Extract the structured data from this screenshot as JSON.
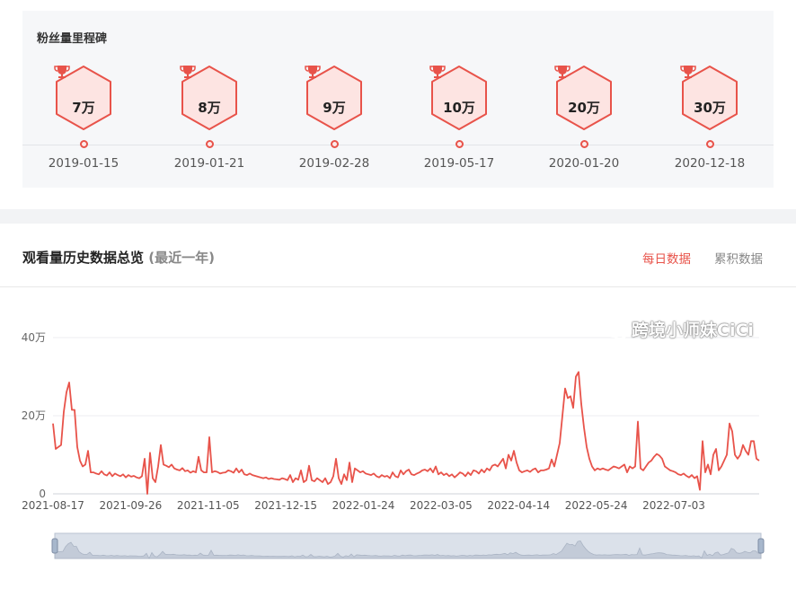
{
  "milestones": {
    "title": "粉丝量里程碑",
    "items": [
      {
        "label": "7万",
        "date": "2019-01-15"
      },
      {
        "label": "8万",
        "date": "2019-01-21"
      },
      {
        "label": "9万",
        "date": "2019-02-28"
      },
      {
        "label": "10万",
        "date": "2019-05-17"
      },
      {
        "label": "20万",
        "date": "2020-01-20"
      },
      {
        "label": "30万",
        "date": "2020-12-18"
      }
    ]
  },
  "views": {
    "title": "观看量历史数据总览",
    "subtitle": "(最近一年)",
    "tabs": {
      "daily": "每日数据",
      "cumulative": "累积数据"
    }
  },
  "watermark": "跨境小师妹CiCi",
  "colors": {
    "accent": "#e8534a",
    "hex_fill": "#fde4e2"
  },
  "chart_data": {
    "type": "line",
    "ylim": [
      0,
      400000
    ],
    "y_ticks": [
      "0",
      "20万",
      "40万"
    ],
    "x_tick_labels": [
      "2021-08-17",
      "2021-09-26",
      "2021-11-05",
      "2021-12-15",
      "2022-01-24",
      "2022-03-05",
      "2022-04-14",
      "2022-05-24",
      "2022-07-03"
    ],
    "series": [
      {
        "values": [
          180000,
          115000,
          120000,
          125000,
          210000,
          260000,
          285000,
          215000,
          215000,
          120000,
          85000,
          70000,
          75000,
          110000,
          55000,
          55000,
          52000,
          50000,
          58000,
          50000,
          47000,
          55000,
          45000,
          52000,
          48000,
          45000,
          50000,
          42000,
          48000,
          44000,
          46000,
          42000,
          40000,
          45000,
          90000,
          0,
          105000,
          40000,
          30000,
          70000,
          125000,
          75000,
          72000,
          68000,
          75000,
          65000,
          62000,
          60000,
          66000,
          58000,
          60000,
          54000,
          58000,
          55000,
          95000,
          60000,
          55000,
          55000,
          145000,
          55000,
          58000,
          56000,
          52000,
          54000,
          55000,
          60000,
          58000,
          54000,
          65000,
          55000,
          62000,
          50000,
          48000,
          52000,
          48000,
          46000,
          44000,
          42000,
          40000,
          42000,
          38000,
          40000,
          38000,
          37000,
          36000,
          40000,
          38000,
          35000,
          48000,
          30000,
          40000,
          36000,
          60000,
          30000,
          35000,
          72000,
          35000,
          32000,
          40000,
          35000,
          30000,
          40000,
          25000,
          30000,
          45000,
          90000,
          40000,
          25000,
          50000,
          35000,
          80000,
          30000,
          65000,
          60000,
          55000,
          58000,
          52000,
          50000,
          48000,
          52000,
          45000,
          42000,
          48000,
          44000,
          46000,
          40000,
          55000,
          45000,
          42000,
          60000,
          50000,
          58000,
          62000,
          50000,
          48000,
          52000,
          55000,
          60000,
          62000,
          58000,
          65000,
          55000,
          70000,
          50000,
          55000,
          48000,
          52000,
          45000,
          50000,
          42000,
          48000,
          55000,
          52000,
          45000,
          55000,
          48000,
          60000,
          58000,
          52000,
          62000,
          55000,
          65000,
          60000,
          72000,
          75000,
          70000,
          80000,
          90000,
          65000,
          100000,
          85000,
          110000,
          80000,
          60000,
          55000,
          58000,
          60000,
          56000,
          62000,
          65000,
          55000,
          60000,
          60000,
          62000,
          65000,
          88000,
          70000,
          100000,
          130000,
          200000,
          270000,
          245000,
          250000,
          220000,
          300000,
          312000,
          230000,
          170000,
          120000,
          90000,
          70000,
          60000,
          65000,
          62000,
          65000,
          62000,
          60000,
          65000,
          70000,
          68000,
          65000,
          70000,
          75000,
          55000,
          70000,
          65000,
          70000,
          185000,
          65000,
          60000,
          70000,
          80000,
          85000,
          95000,
          102000,
          98000,
          90000,
          70000,
          65000,
          60000,
          58000,
          55000,
          50000,
          48000,
          52000,
          46000,
          42000,
          48000,
          40000,
          45000,
          10000,
          135000,
          55000,
          75000,
          50000,
          100000,
          115000,
          60000,
          70000,
          85000,
          100000,
          180000,
          160000,
          100000,
          90000,
          100000,
          125000,
          110000,
          100000,
          135000,
          135000,
          90000,
          85000
        ]
      }
    ],
    "x_range": [
      "2021-08-17",
      "2022-08-16"
    ]
  }
}
